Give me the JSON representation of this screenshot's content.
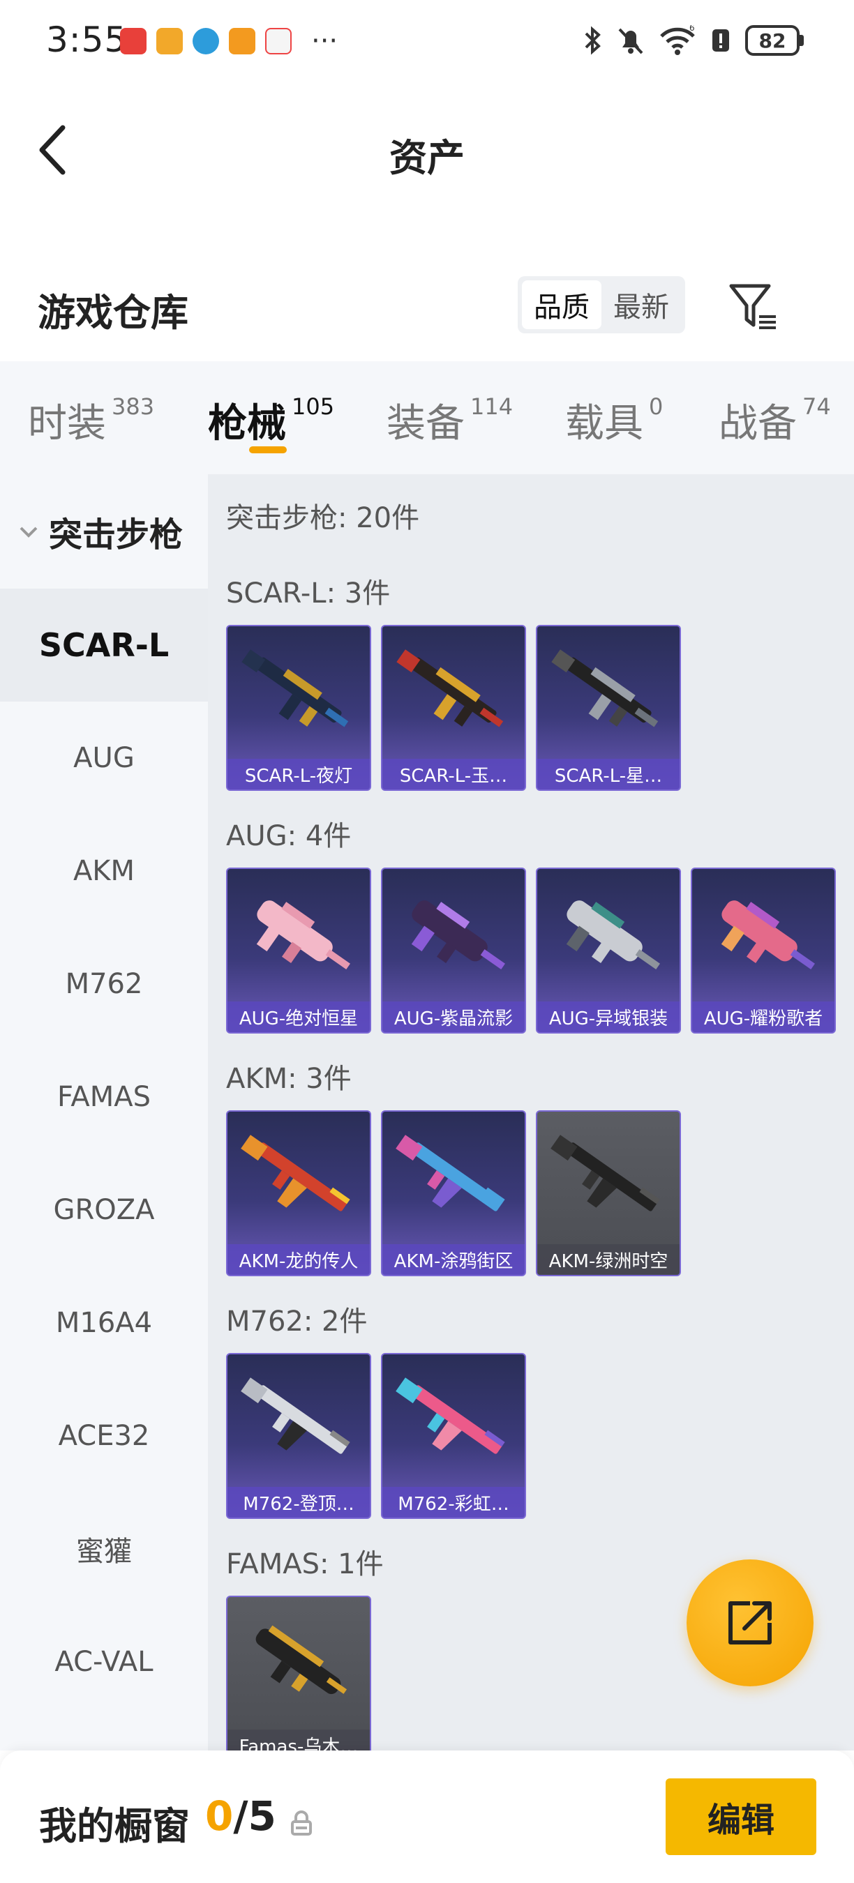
{
  "status": {
    "time": "3:55",
    "battery": "82",
    "more": "···",
    "network_sup": "6"
  },
  "header": {
    "title": "资产",
    "back_icon": "chevron-left-icon"
  },
  "warehouse": {
    "title": "游戏仓库",
    "sort": [
      "品质",
      "最新"
    ],
    "active_sort": "品质",
    "filter_icon": "filter-icon"
  },
  "tabs": [
    {
      "label": "时装",
      "count": "383"
    },
    {
      "label": "枪械",
      "count": "105"
    },
    {
      "label": "装备",
      "count": "114"
    },
    {
      "label": "载具",
      "count": "0"
    },
    {
      "label": "战备",
      "count": "74"
    }
  ],
  "active_tab": "枪械",
  "sidebar": {
    "category": "突击步枪",
    "items": [
      "SCAR-L",
      "AUG",
      "AKM",
      "M762",
      "FAMAS",
      "GROZA",
      "M16A4",
      "ACE32",
      "蜜獾",
      "AC-VAL"
    ],
    "active": "SCAR-L"
  },
  "main": {
    "total": "突击步枪: 20件",
    "groups": [
      {
        "title": "SCAR-L: 3件",
        "items": [
          "SCAR-L-夜灯",
          "SCAR-L-玉…",
          "SCAR-L-星…"
        ]
      },
      {
        "title": "AUG: 4件",
        "items": [
          "AUG-绝对恒星",
          "AUG-紫晶流影",
          "AUG-异域银装",
          "AUG-耀粉歌者"
        ]
      },
      {
        "title": "AKM: 3件",
        "items": [
          "AKM-龙的传人",
          "AKM-涂鸦街区",
          "AKM-绿洲时空"
        ]
      },
      {
        "title": "M762: 2件",
        "items": [
          "M762-登顶…",
          "M762-彩虹…"
        ]
      },
      {
        "title": "FAMAS: 1件",
        "items": [
          "Famas-乌木…"
        ]
      }
    ]
  },
  "colors": {
    "accent": "#f5a300",
    "card_purple": "#3b3a7a"
  },
  "bottom": {
    "showcase_label": "我的橱窗",
    "showcase_current": "0",
    "showcase_sep": "/",
    "showcase_max": "5",
    "edit_label": "编辑"
  }
}
